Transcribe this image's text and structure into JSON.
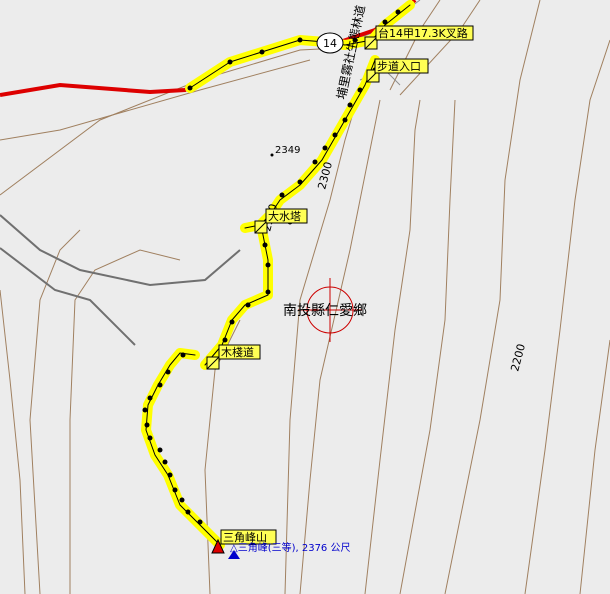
{
  "map": {
    "colors": {
      "background": "#ececec",
      "contour": "#a08060",
      "boundary": "#707070",
      "track_highlight": "#ffff00",
      "track_line": "#000000",
      "highway": "#dd0000",
      "target": "#cc0000",
      "summit_label": "#0000cc"
    },
    "admin_label": "南投縣仁愛鄉",
    "road_name": "埔里霧社生態林道",
    "highway_number": "14",
    "contour_labels": [
      "2300",
      "2300",
      "2200"
    ],
    "spot_height": "2349",
    "waypoints": [
      {
        "name": "台14甲17.3K叉路",
        "icon": "waypoint-flag-icon"
      },
      {
        "name": "步道入口",
        "icon": "waypoint-flag-icon"
      },
      {
        "name": "大水塔",
        "icon": "waypoint-flag-icon"
      },
      {
        "name": "木棧道",
        "icon": "waypoint-flag-icon"
      },
      {
        "name": "三角峰山",
        "icon": "summit-triangle-icon"
      }
    ],
    "summit": {
      "label": "△三角峰(三等), 2376 公尺",
      "icon": "triangulation-point-icon"
    }
  }
}
